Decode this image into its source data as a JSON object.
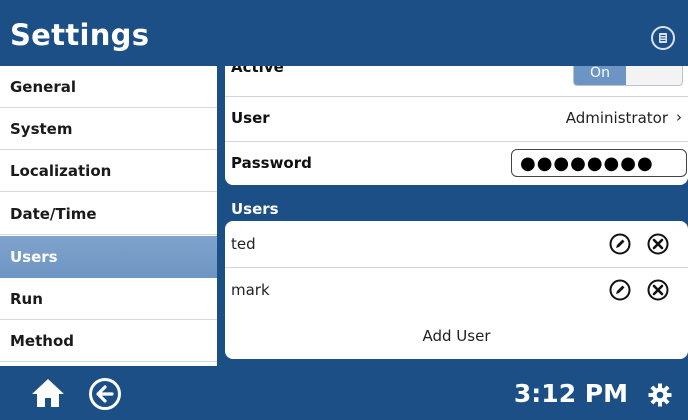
{
  "header": {
    "title": "Settings",
    "info_icon": "device-info-icon"
  },
  "sidebar": {
    "items": [
      {
        "label": "General"
      },
      {
        "label": "System"
      },
      {
        "label": "Localization"
      },
      {
        "label": "Date/Time"
      },
      {
        "label": "Users",
        "active": true
      },
      {
        "label": "Run"
      },
      {
        "label": "Method"
      }
    ]
  },
  "account": {
    "active_label": "Active",
    "toggle_state": "On",
    "user_label": "User",
    "user_value": "Administrator",
    "password_label": "Password",
    "password_value": "●●●●●●●●"
  },
  "users": {
    "heading": "Users",
    "list": [
      {
        "name": "ted"
      },
      {
        "name": "mark"
      }
    ],
    "add_label": "Add User"
  },
  "footer": {
    "time": "3:12 PM",
    "icons": [
      "home-icon",
      "back-arrow-icon",
      "gear-icon"
    ]
  },
  "colors": {
    "primary": "#1b4f86",
    "active": "#6d95c3"
  }
}
